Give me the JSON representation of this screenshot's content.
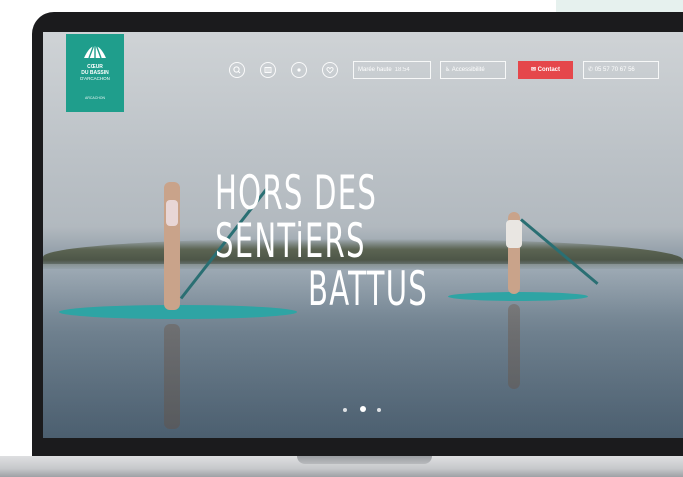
{
  "header": {
    "logo": {
      "line1": "CŒUR",
      "line2": "DU BASSIN",
      "line3": "D'ARCACHON",
      "tagline": "ARCACHON"
    },
    "icons": [
      "search-icon",
      "map-icon",
      "globe-icon",
      "heart-icon"
    ],
    "tide": {
      "label": "Marée haute",
      "time": "18:54"
    },
    "accessibility_label": "Accessibilité",
    "contact_label": "Contact",
    "phone": "05 57 70 67 56"
  },
  "hero": {
    "line1": "HORS DES SENTiERS",
    "line2": "BATTUS"
  },
  "slider": {
    "slide_count": 3,
    "active_index": 1
  },
  "colors": {
    "brand_teal": "#1f9e8c",
    "contact_red": "#e5474b",
    "board": "#2ea4a4"
  }
}
